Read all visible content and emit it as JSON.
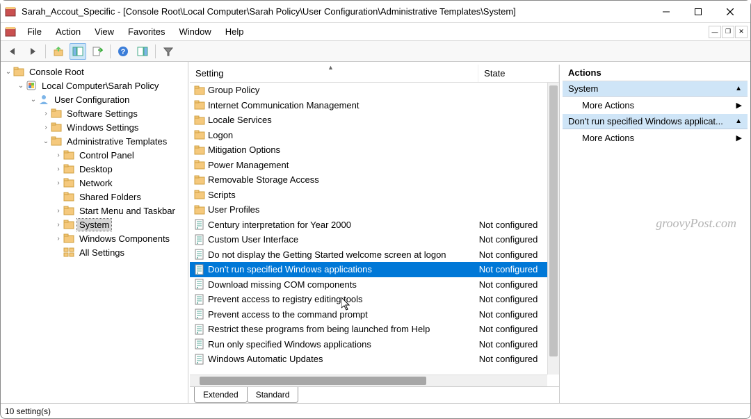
{
  "window": {
    "title": "Sarah_Accout_Specific - [Console Root\\Local Computer\\Sarah Policy\\User Configuration\\Administrative Templates\\System]"
  },
  "menu": [
    "File",
    "Action",
    "View",
    "Favorites",
    "Window",
    "Help"
  ],
  "tree": {
    "root": "Console Root",
    "nodes": [
      {
        "label": "Local Computer\\Sarah Policy",
        "indent": 1,
        "expanded": true,
        "icon": "shield"
      },
      {
        "label": "User Configuration",
        "indent": 2,
        "expanded": true,
        "icon": "user"
      },
      {
        "label": "Software Settings",
        "indent": 3,
        "expanded": false,
        "icon": "folder"
      },
      {
        "label": "Windows Settings",
        "indent": 3,
        "expanded": false,
        "icon": "folder"
      },
      {
        "label": "Administrative Templates",
        "indent": 3,
        "expanded": true,
        "icon": "folder"
      },
      {
        "label": "Control Panel",
        "indent": 4,
        "expanded": false,
        "icon": "folder"
      },
      {
        "label": "Desktop",
        "indent": 4,
        "expanded": false,
        "icon": "folder"
      },
      {
        "label": "Network",
        "indent": 4,
        "expanded": false,
        "icon": "folder"
      },
      {
        "label": "Shared Folders",
        "indent": 4,
        "expanded": false,
        "icon": "folder",
        "no_toggle": true
      },
      {
        "label": "Start Menu and Taskbar",
        "indent": 4,
        "expanded": false,
        "icon": "folder"
      },
      {
        "label": "System",
        "indent": 4,
        "expanded": false,
        "icon": "folder",
        "selected": true
      },
      {
        "label": "Windows Components",
        "indent": 4,
        "expanded": false,
        "icon": "folder"
      },
      {
        "label": "All Settings",
        "indent": 4,
        "expanded": false,
        "icon": "allsettings",
        "no_toggle": true
      }
    ]
  },
  "list": {
    "headers": {
      "setting": "Setting",
      "state": "State"
    },
    "rows": [
      {
        "setting": "Group Policy",
        "state": "",
        "type": "folder"
      },
      {
        "setting": "Internet Communication Management",
        "state": "",
        "type": "folder"
      },
      {
        "setting": "Locale Services",
        "state": "",
        "type": "folder"
      },
      {
        "setting": "Logon",
        "state": "",
        "type": "folder"
      },
      {
        "setting": "Mitigation Options",
        "state": "",
        "type": "folder"
      },
      {
        "setting": "Power Management",
        "state": "",
        "type": "folder"
      },
      {
        "setting": "Removable Storage Access",
        "state": "",
        "type": "folder"
      },
      {
        "setting": "Scripts",
        "state": "",
        "type": "folder"
      },
      {
        "setting": "User Profiles",
        "state": "",
        "type": "folder"
      },
      {
        "setting": "Century interpretation for Year 2000",
        "state": "Not configured",
        "type": "policy"
      },
      {
        "setting": "Custom User Interface",
        "state": "Not configured",
        "type": "policy"
      },
      {
        "setting": "Do not display the Getting Started welcome screen at logon",
        "state": "Not configured",
        "type": "policy"
      },
      {
        "setting": "Don't run specified Windows applications",
        "state": "Not configured",
        "type": "policy",
        "selected": true
      },
      {
        "setting": "Download missing COM components",
        "state": "Not configured",
        "type": "policy"
      },
      {
        "setting": "Prevent access to registry editing tools",
        "state": "Not configured",
        "type": "policy"
      },
      {
        "setting": "Prevent access to the command prompt",
        "state": "Not configured",
        "type": "policy"
      },
      {
        "setting": "Restrict these programs from being launched from Help",
        "state": "Not configured",
        "type": "policy"
      },
      {
        "setting": "Run only specified Windows applications",
        "state": "Not configured",
        "type": "policy"
      },
      {
        "setting": "Windows Automatic Updates",
        "state": "Not configured",
        "type": "policy"
      }
    ],
    "tabs": {
      "extended": "Extended",
      "standard": "Standard"
    }
  },
  "actions": {
    "header": "Actions",
    "groups": [
      {
        "title": "System",
        "items": [
          "More Actions"
        ]
      },
      {
        "title": "Don't run specified Windows applicat...",
        "items": [
          "More Actions"
        ]
      }
    ]
  },
  "statusbar": "10 setting(s)",
  "watermark": "groovyPost.com"
}
